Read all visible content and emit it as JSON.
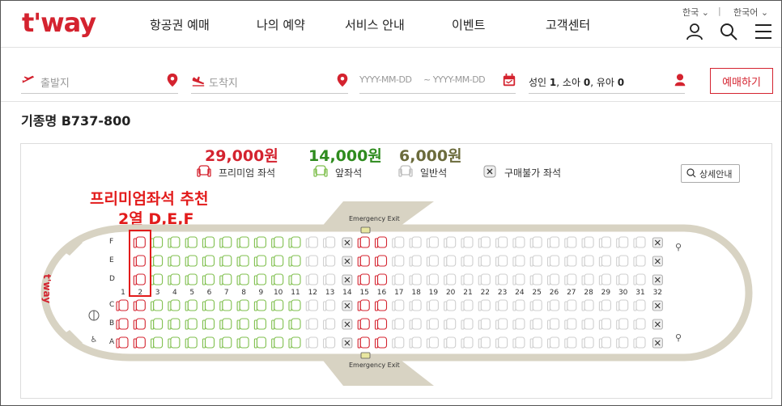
{
  "header": {
    "logo": "t'way",
    "nav": [
      "항공권 예매",
      "나의 예약",
      "서비스 안내",
      "이벤트",
      "고객센터"
    ],
    "region": "한국",
    "language": "한국어",
    "separator": "|"
  },
  "search": {
    "origin_placeholder": "출발지",
    "destination_placeholder": "도착지",
    "date_from_placeholder": "YYYY-MM-DD",
    "date_to_placeholder": "~ YYYY-MM-DD",
    "passengers": {
      "adult_label": "성인",
      "adult_count": "1",
      "child_label": "소아",
      "child_count": "0",
      "infant_label": "유아",
      "infant_count": "0"
    },
    "book_button": "예매하기"
  },
  "aircraft_title": "기종명 B737-800",
  "legend": {
    "items": [
      {
        "price": "29,000원",
        "label": "프리미엄 좌석",
        "color": "#d4232f"
      },
      {
        "price": "14,000원",
        "label": "앞좌석",
        "color": "#2e8b1e"
      },
      {
        "price": "6,000원",
        "label": "일반석",
        "color": "#6b6b3c"
      },
      {
        "price": "",
        "label": "구매불가 좌석",
        "color": "#9a9a9a"
      }
    ],
    "detail_button": "상세안내"
  },
  "recommendation": {
    "line1": "프리미엄좌석 추천",
    "line2": "2열 D,E,F"
  },
  "seatmap": {
    "row_letters_top": [
      "F",
      "E",
      "D"
    ],
    "row_letters_bottom": [
      "C",
      "B",
      "A"
    ],
    "columns": [
      "1",
      "2",
      "3",
      "4",
      "5",
      "6",
      "7",
      "8",
      "9",
      "10",
      "11",
      "12",
      "13",
      "14",
      "15",
      "16",
      "17",
      "18",
      "19",
      "20",
      "21",
      "22",
      "23",
      "24",
      "25",
      "26",
      "27",
      "28",
      "29",
      "30",
      "31",
      "32"
    ],
    "emergency_exit_label": "Emergency Exit",
    "fuselage_logo": "t'way",
    "colors": {
      "premium": "#d4232f",
      "front": "#7fbf4d",
      "normal": "#cfcfcf",
      "blocked": "#9a9a9a",
      "fuselage": "#d8d3c3"
    }
  }
}
